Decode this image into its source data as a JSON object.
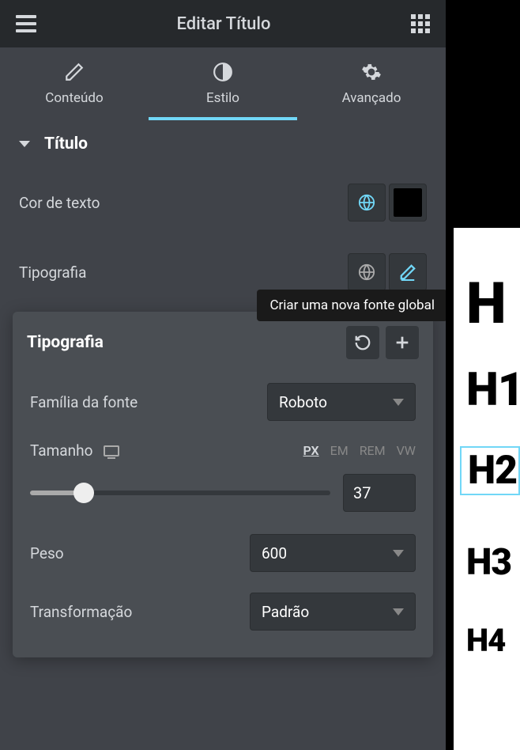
{
  "header": {
    "title": "Editar Título"
  },
  "tabs": {
    "content": "Conteúdo",
    "style": "Estilo",
    "advanced": "Avançado"
  },
  "section": {
    "title": "Título"
  },
  "controls": {
    "text_color_label": "Cor de texto",
    "typography_label": "Tipografia"
  },
  "tooltip": {
    "create_global_font": "Criar uma nova fonte global"
  },
  "popover": {
    "title": "Tipografia",
    "font_family_label": "Família da fonte",
    "font_family_value": "Roboto",
    "size_label": "Tamanho",
    "size_value": "37",
    "units": {
      "px": "PX",
      "em": "EM",
      "rem": "REM",
      "vw": "VW"
    },
    "weight_label": "Peso",
    "weight_value": "600",
    "transform_label": "Transformação",
    "transform_value": "Padrão"
  },
  "canvas": {
    "h1": "H",
    "h1b": "H1",
    "h2": "H2",
    "h3": "H3",
    "h4": "H4"
  }
}
